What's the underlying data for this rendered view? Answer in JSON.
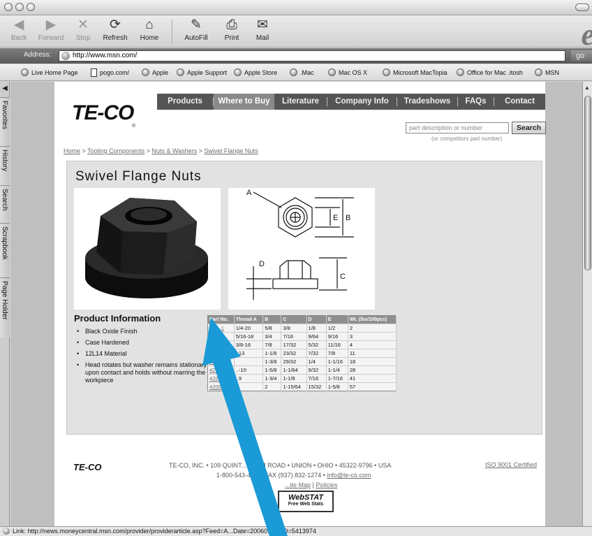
{
  "toolbar": {
    "back": "Back",
    "forward": "Forward",
    "stop": "Stop",
    "refresh": "Refresh",
    "home": "Home",
    "autofill": "AutoFill",
    "print": "Print",
    "mail": "Mail"
  },
  "address": {
    "label": "Address:",
    "url": "http://www.msn.com/",
    "go": "go"
  },
  "favorites": [
    "Live Home Page",
    "pogo.com/",
    "Apple",
    "Apple Support",
    "Apple Store",
    ".Mac",
    "Mac OS X",
    "Microsoft MacTopia",
    "Office for Mac .itosh",
    "MSN"
  ],
  "sidebar_tabs": [
    "Favorites",
    "History",
    "Search",
    "Scrapbook",
    "Page Holder"
  ],
  "status": {
    "text": "Link: http://news.moneycentral.msn.com/provider/providerarticle.asp?Feed=A...Date=20060113&ID=5413974"
  },
  "site": {
    "logo": "TE-CO",
    "logo_mark": "®",
    "nav": [
      "Products",
      "Where to Buy",
      "Literature",
      "Company Info",
      "Tradeshows",
      "FAQs",
      "Contact"
    ],
    "search": {
      "placeholder": "part description or number",
      "button": "Search",
      "hint": "(or competitors part number)"
    },
    "breadcrumb": [
      "Home",
      "Tooling Components",
      "Nuts & Washers",
      "Swivel Flange Nuts"
    ],
    "breadcrumb_sep": " > ",
    "page_title": "Swivel Flange Nuts",
    "diagram_labels": {
      "a": "A",
      "b": "B",
      "c": "C",
      "d": "D",
      "e": "E"
    },
    "product_info": {
      "title": "Product Information",
      "items": [
        "Black Oxide Finish",
        "Case Hardened",
        "12L14 Material",
        "Head rotates but washer remains stationary upon contact and holds without marring the workpiece"
      ]
    },
    "table": {
      "headers": [
        "Part No.",
        "Thread A",
        "B",
        "C",
        "D",
        "E",
        "Wt. (lbs/100pcs)"
      ],
      "rows": [
        [
          "420..1",
          "1/4-20",
          "5/8",
          "3/8",
          "1/8",
          "1/2",
          "2"
        ],
        [
          "420..",
          "5/16-18",
          "3/4",
          "7/16",
          "9/64",
          "9/16",
          "3"
        ],
        [
          "420..",
          "3/8-16",
          "7/8",
          "17/32",
          "5/32",
          "11/16",
          "4"
        ],
        [
          "42..",
          "..13",
          "1-1/8",
          "23/32",
          "7/32",
          "7/8",
          "11"
        ],
        [
          "42..",
          "",
          "1-3/8",
          "29/32",
          "1/4",
          "1-1/16",
          "18"
        ],
        [
          "42..",
          "..-10",
          "1-5/8",
          "1-1/64",
          "9/32",
          "1-1/4",
          "28"
        ],
        [
          "42007",
          "..9",
          "1-3/4",
          "1-1/8",
          "7/16",
          "1-7/16",
          "41"
        ],
        [
          "42008",
          "",
          "2",
          "1-15/64",
          "15/32",
          "1-5/8",
          "57"
        ]
      ]
    },
    "footer": {
      "logo": "TE-CO",
      "line1": "TE-CO, INC. • 109 QUINT... FARM ROAD • UNION • OHIO • 45322-9796 • USA",
      "line2_prefix": "1-800-543-407... FAX (937) 832-1274 • ",
      "email": "info@te-co.com",
      "site_map": "...ite Map",
      "sep": " | ",
      "policies": "Policies",
      "iso": "ISO 9001 Certified",
      "webstat_1": "WebSTAT",
      "webstat_2": "Free Web Stats"
    }
  },
  "colors": {
    "arrow": "#1a9ad6",
    "nav_bg": "#555555",
    "panel_bg": "#e2e2e2"
  }
}
